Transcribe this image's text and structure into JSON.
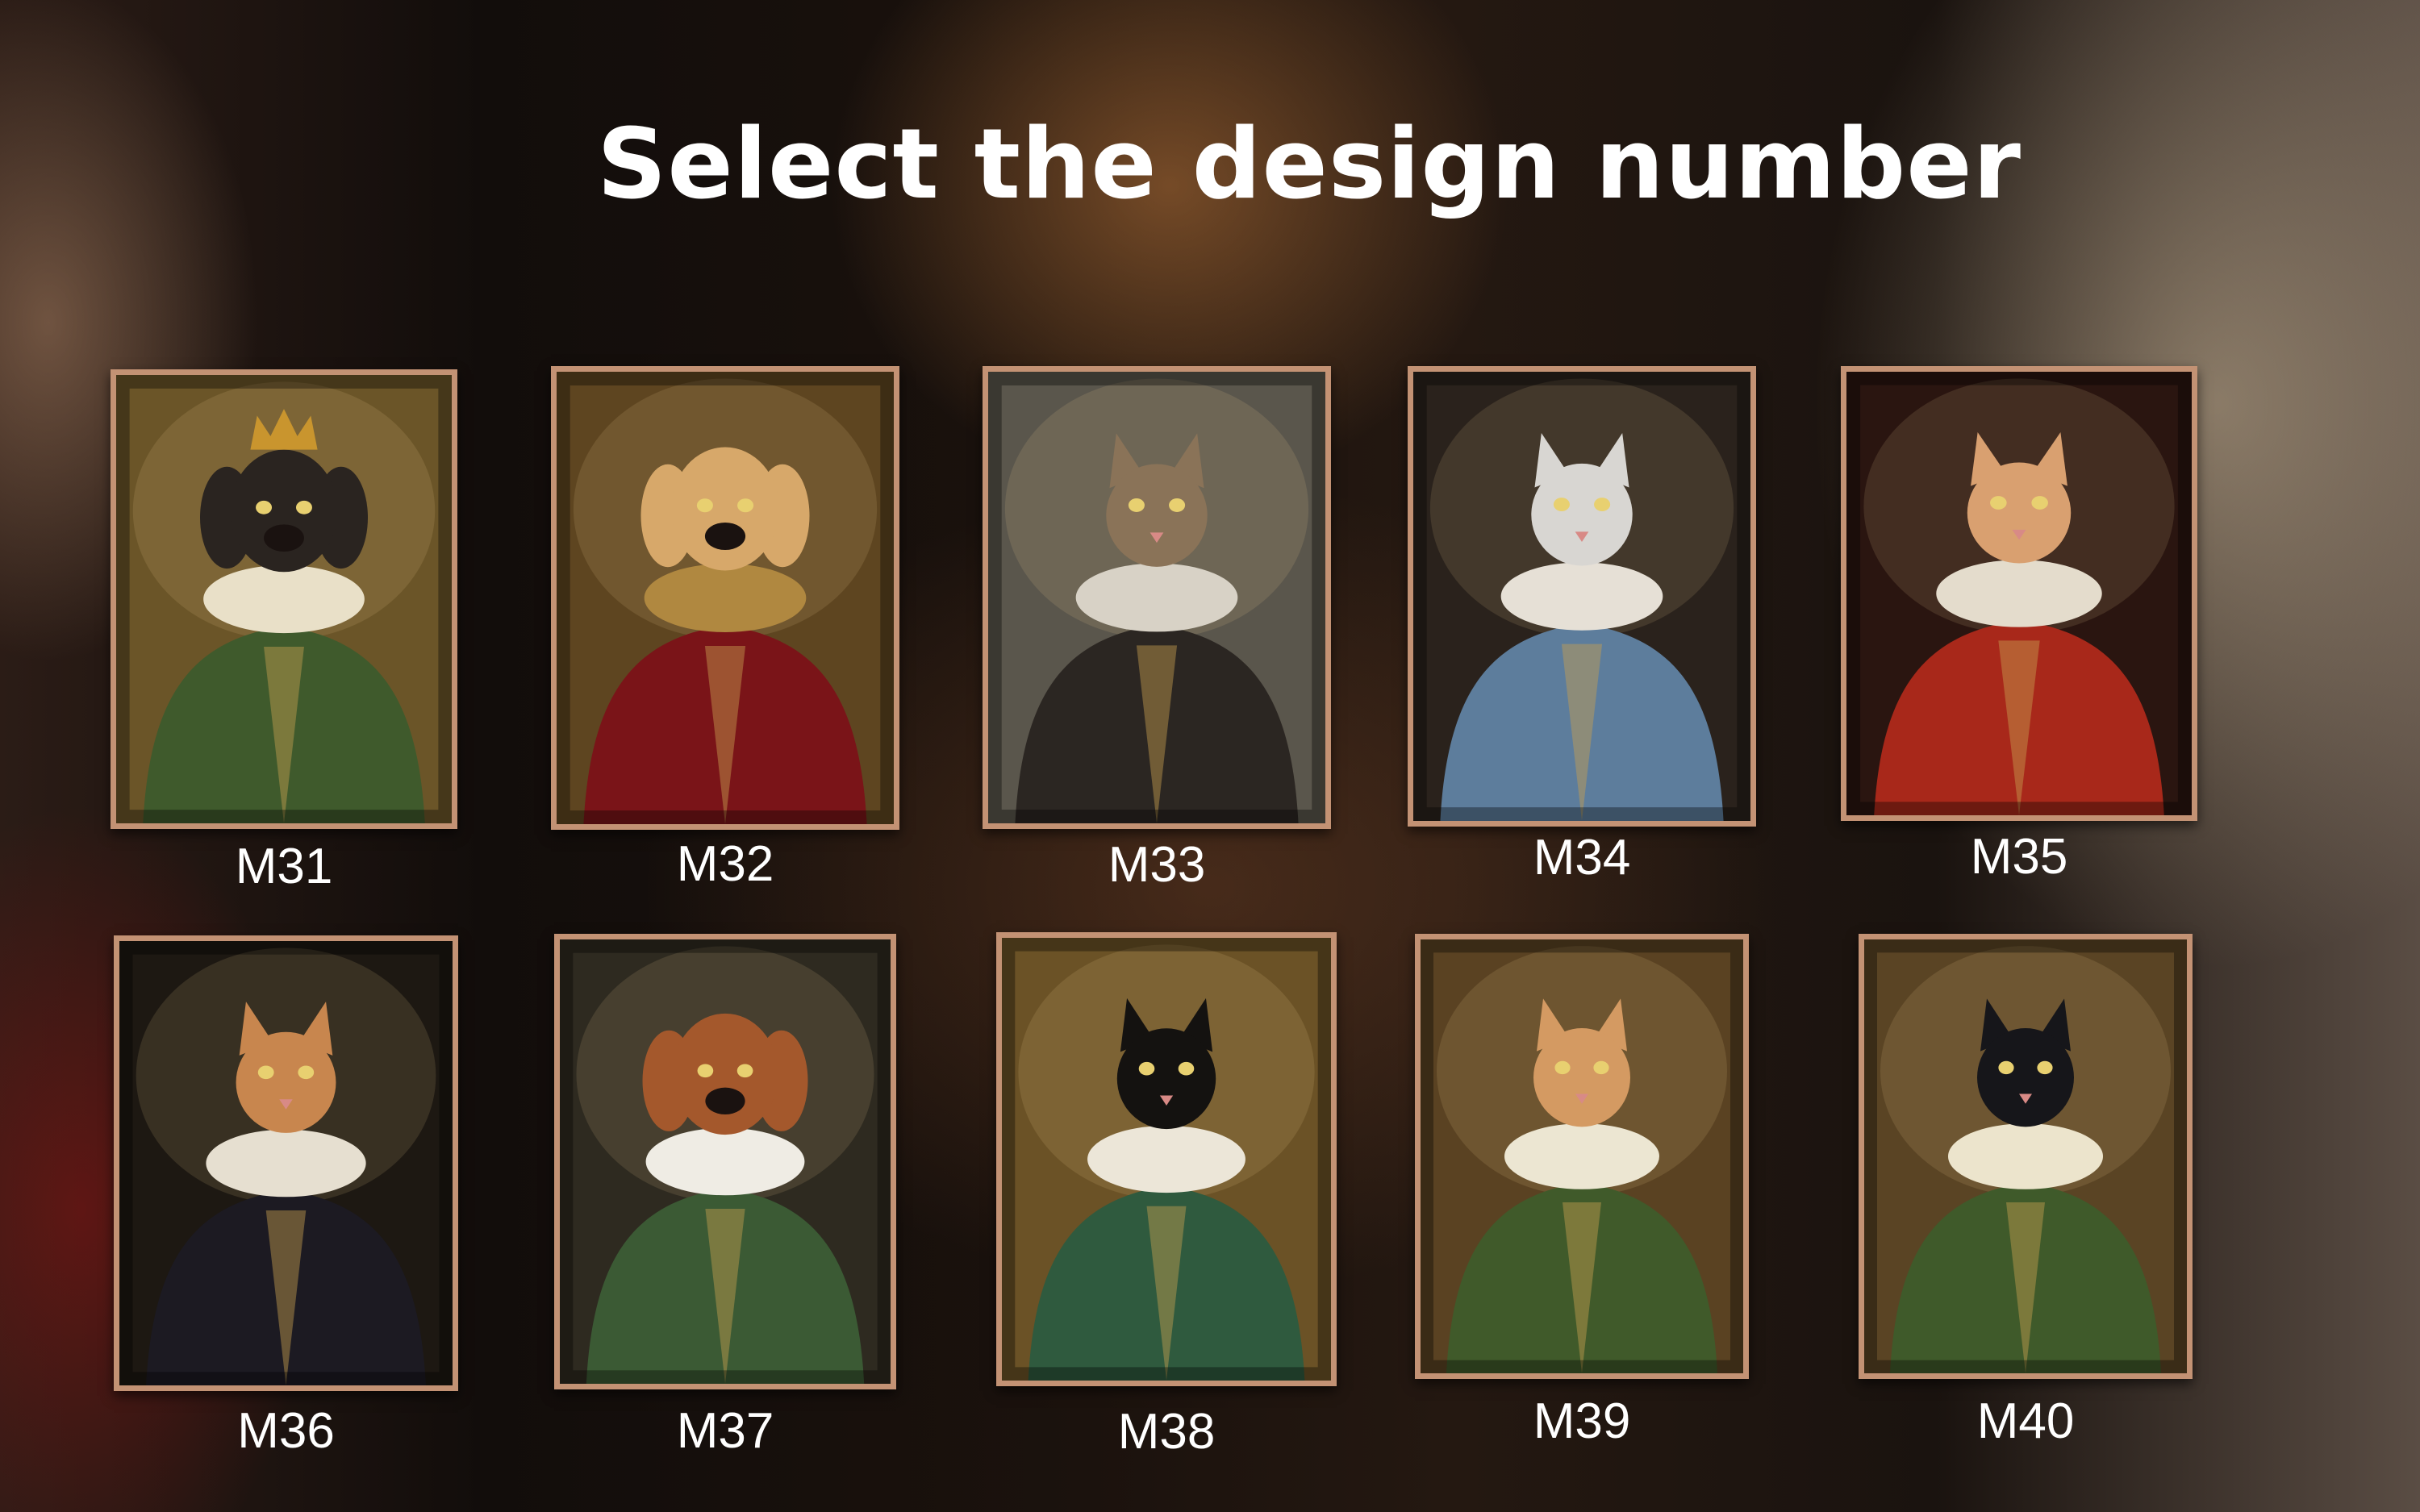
{
  "page": {
    "title": "Select the design number"
  },
  "designs": [
    {
      "label": "M31",
      "subject": "dog-portrait",
      "bg": "#6b5528",
      "coat": "#3f5a2c",
      "collar": "#e9e0c8",
      "head": "#2a2420",
      "crown": true
    },
    {
      "label": "M32",
      "subject": "dog-portrait",
      "bg": "#5e4520",
      "coat": "#7a1418",
      "collar": "#b08840",
      "head": "#d7a86a",
      "crown": false
    },
    {
      "label": "M33",
      "subject": "cat-portrait",
      "bg": "#5a564c",
      "coat": "#2b2622",
      "collar": "#d8d2c6",
      "head": "#8a7358",
      "crown": false
    },
    {
      "label": "M34",
      "subject": "cat-portrait",
      "bg": "#2a221c",
      "coat": "#5d7d9c",
      "collar": "#e6e0d6",
      "head": "#d8d6d2",
      "crown": false
    },
    {
      "label": "M35",
      "subject": "cat-portrait",
      "bg": "#2a1510",
      "coat": "#a8281a",
      "collar": "#e4dccc",
      "head": "#d9a070",
      "crown": false
    },
    {
      "label": "M36",
      "subject": "cat-portrait",
      "bg": "#1d1812",
      "coat": "#1c1a22",
      "collar": "#e6dfd0",
      "head": "#c8864e",
      "crown": false
    },
    {
      "label": "M37",
      "subject": "dog-portrait",
      "bg": "#2e2a20",
      "coat": "#3b5a34",
      "collar": "#efece4",
      "head": "#a4582c",
      "crown": false
    },
    {
      "label": "M38",
      "subject": "cat-portrait",
      "bg": "#6b5226",
      "coat": "#2f5a3e",
      "collar": "#ece6d8",
      "head": "#141210",
      "crown": false
    },
    {
      "label": "M39",
      "subject": "cat-portrait",
      "bg": "#5a4222",
      "coat": "#405a2a",
      "collar": "#ece6d2",
      "head": "#d49a62",
      "crown": false
    },
    {
      "label": "M40",
      "subject": "cat-portrait",
      "bg": "#5a4424",
      "coat": "#3f5a2a",
      "collar": "#ece4cc",
      "head": "#16161a",
      "crown": false
    }
  ],
  "colors": {
    "frame": "#c39274",
    "text": "#ffffff"
  }
}
